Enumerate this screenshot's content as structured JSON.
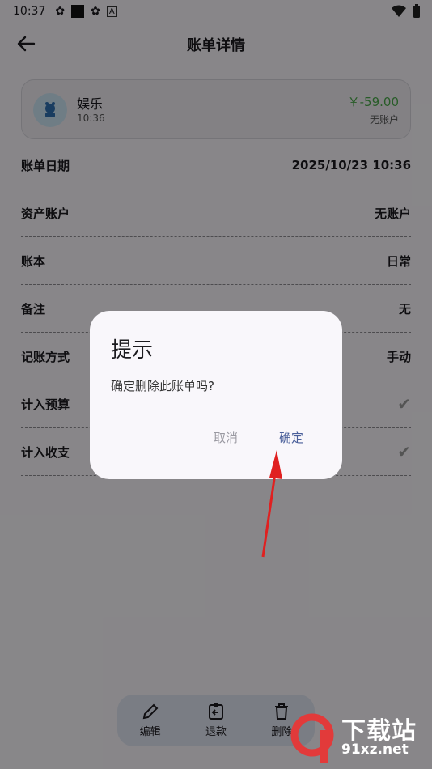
{
  "status": {
    "time": "10:37"
  },
  "header": {
    "title": "账单详情"
  },
  "summary": {
    "category": "娱乐",
    "time": "10:36",
    "amount": "￥-59.00",
    "account": "无账户"
  },
  "rows": [
    {
      "label": "账单日期",
      "value": "2025/10/23 10:36"
    },
    {
      "label": "资产账户",
      "value": "无账户"
    },
    {
      "label": "账本",
      "value": "日常"
    },
    {
      "label": "备注",
      "value": "无"
    },
    {
      "label": "记账方式",
      "value": "手动"
    },
    {
      "label": "计入预算",
      "value": "✔"
    },
    {
      "label": "计入收支",
      "value": "✔"
    }
  ],
  "actions": {
    "edit": "编辑",
    "refund": "退款",
    "delete": "删除"
  },
  "dialog": {
    "title": "提示",
    "message": "确定删除此账单吗?",
    "cancel": "取消",
    "confirm": "确定"
  },
  "watermark": {
    "brand": "下载站",
    "site": "91xz.net"
  },
  "colors": {
    "income_expense": "#4aa84a",
    "confirm": "#4a5f9a",
    "arrow": "#e02020"
  }
}
